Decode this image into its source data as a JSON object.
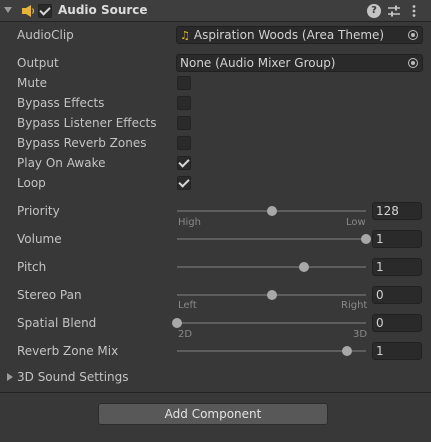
{
  "header": {
    "title": "Audio Source",
    "enabled": true,
    "icons": [
      "foldout-arrow-icon",
      "audio-source-speaker-icon",
      "help-icon",
      "presets-icon",
      "more-menu-icon"
    ]
  },
  "fields": {
    "audioclip": {
      "label": "AudioClip",
      "value": "Aspiration Woods (Area Theme)",
      "icon": "audio-note-icon"
    },
    "output": {
      "label": "Output",
      "value": "None (Audio Mixer Group)"
    },
    "mute": {
      "label": "Mute",
      "checked": false
    },
    "bypass_effects": {
      "label": "Bypass Effects",
      "checked": false
    },
    "bypass_listener_effects": {
      "label": "Bypass Listener Effects",
      "checked": false
    },
    "bypass_reverb_zones": {
      "label": "Bypass Reverb Zones",
      "checked": false
    },
    "play_on_awake": {
      "label": "Play On Awake",
      "checked": true
    },
    "loop": {
      "label": "Loop",
      "checked": true
    }
  },
  "sliders": {
    "priority": {
      "label": "Priority",
      "value": "128",
      "min_label": "High",
      "max_label": "Low",
      "fraction": 0.5
    },
    "volume": {
      "label": "Volume",
      "value": "1",
      "fraction": 1.0
    },
    "pitch": {
      "label": "Pitch",
      "value": "1",
      "fraction": 0.67
    },
    "stereo_pan": {
      "label": "Stereo Pan",
      "value": "0",
      "min_label": "Left",
      "max_label": "Right",
      "fraction": 0.5
    },
    "spatial_blend": {
      "label": "Spatial Blend",
      "value": "0",
      "min_label": "2D",
      "max_label": "3D",
      "fraction": 0.0
    },
    "reverb_zone_mix": {
      "label": "Reverb Zone Mix",
      "value": "1",
      "fraction": 0.9
    }
  },
  "sound_settings": {
    "label": "3D Sound Settings"
  },
  "add_component": {
    "label": "Add Component"
  },
  "colors": {
    "background": "#383838",
    "header": "#3e3e3e",
    "field": "#2a2a2a",
    "clip_note": "#e8b33a",
    "button": "#585858"
  }
}
